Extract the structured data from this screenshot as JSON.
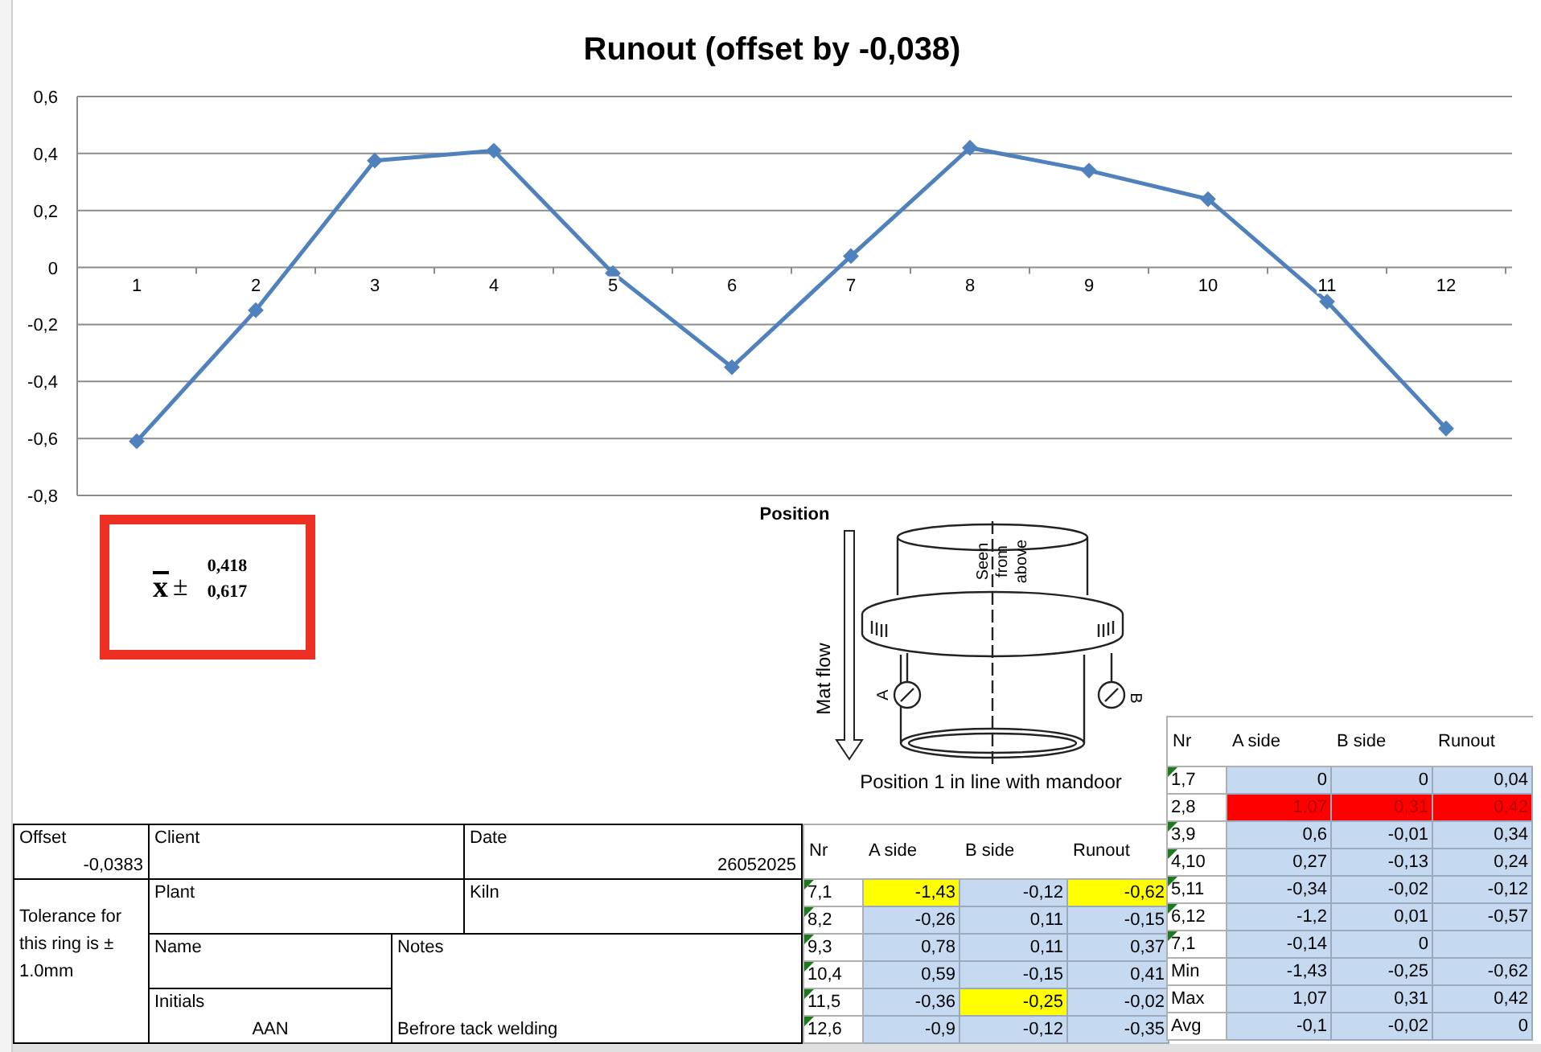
{
  "chart": {
    "chart_data": {
      "type": "line",
      "title": "Runout (offset by -0,038)",
      "xlabel": "Position",
      "categories": [
        "1",
        "2",
        "3",
        "4",
        "5",
        "6",
        "7",
        "8",
        "9",
        "10",
        "11",
        "12"
      ],
      "grid": true,
      "series": [
        {
          "color": "#4f81bd",
          "marker": "diamond",
          "values": [
            -0.61,
            -0.15,
            0.375,
            0.41,
            -0.02,
            -0.35,
            0.04,
            0.42,
            0.34,
            0.24,
            -0.12,
            -0.565
          ]
        }
      ],
      "ylim": [
        -0.8,
        0.6
      ],
      "yticks": [
        {
          "value": 0.6,
          "label": "0,6"
        },
        {
          "value": 0.4,
          "label": "0,4"
        },
        {
          "value": 0.2,
          "label": "0,2"
        },
        {
          "value": 0,
          "label": "0"
        },
        {
          "value": -0.2,
          "label": "-0,2"
        },
        {
          "value": -0.4,
          "label": "-0,4"
        },
        {
          "value": -0.6,
          "label": "-0,6"
        },
        {
          "value": -0.8,
          "label": "-0,8"
        }
      ]
    }
  },
  "mean_box": {
    "symbol": "x",
    "plus_minus": "±",
    "values": [
      "0,418",
      "0,617"
    ]
  },
  "diagram": {
    "seen_from": [
      "Seen",
      "from",
      "above"
    ],
    "flow_label": "Mat flow",
    "gauge_a": "A",
    "gauge_b": "B",
    "caption": "Position 1 in line with mandoor"
  },
  "info": {
    "offset": {
      "label": "Offset",
      "value": "-0,0383"
    },
    "client": {
      "label": "Client"
    },
    "date": {
      "label": "Date",
      "value": "26052025"
    },
    "tolerance": "Tolerance for this ring is ± 1.0mm",
    "plant": {
      "label": "Plant"
    },
    "kiln": {
      "label": "Kiln"
    },
    "name": {
      "label": "Name"
    },
    "notes": {
      "label": "Notes",
      "value": "Befrore tack welding"
    },
    "initials": {
      "label": "Initials",
      "value": "AAN"
    }
  },
  "table_left": {
    "columns": [
      "Nr",
      "A side",
      "B side",
      "Runout"
    ],
    "rows": [
      {
        "nr": "7,1",
        "flagged": true,
        "cells": [
          {
            "text": "-1,43",
            "color": "#ffff00"
          },
          {
            "text": "-0,12",
            "color": "#c5d9f1"
          },
          {
            "text": "-0,62",
            "color": "#ffff00"
          }
        ]
      },
      {
        "nr": "8,2",
        "flagged": true,
        "cells": [
          {
            "text": "-0,26",
            "color": "#c5d9f1"
          },
          {
            "text": "0,11",
            "color": "#c5d9f1"
          },
          {
            "text": "-0,15",
            "color": "#c5d9f1"
          }
        ]
      },
      {
        "nr": "9,3",
        "flagged": true,
        "cells": [
          {
            "text": "0,78",
            "color": "#c5d9f1"
          },
          {
            "text": "0,11",
            "color": "#c5d9f1"
          },
          {
            "text": "0,37",
            "color": "#c5d9f1"
          }
        ]
      },
      {
        "nr": "10,4",
        "flagged": true,
        "cells": [
          {
            "text": "0,59",
            "color": "#c5d9f1"
          },
          {
            "text": "-0,15",
            "color": "#c5d9f1"
          },
          {
            "text": "0,41",
            "color": "#c5d9f1"
          }
        ]
      },
      {
        "nr": "11,5",
        "flagged": true,
        "cells": [
          {
            "text": "-0,36",
            "color": "#c5d9f1"
          },
          {
            "text": "-0,25",
            "color": "#ffff00"
          },
          {
            "text": "-0,02",
            "color": "#c5d9f1"
          }
        ]
      },
      {
        "nr": "12,6",
        "flagged": true,
        "cells": [
          {
            "text": "-0,9",
            "color": "#c5d9f1"
          },
          {
            "text": "-0,12",
            "color": "#c5d9f1"
          },
          {
            "text": "-0,35",
            "color": "#c5d9f1"
          }
        ]
      }
    ]
  },
  "table_right": {
    "columns": [
      "Nr",
      "A side",
      "B side",
      "Runout"
    ],
    "rows": [
      {
        "nr": "1,7",
        "flagged": true,
        "cells": [
          {
            "text": "0",
            "color": "#c5d9f1"
          },
          {
            "text": "0",
            "color": "#c5d9f1"
          },
          {
            "text": "0,04",
            "color": "#c5d9f1"
          }
        ]
      },
      {
        "nr": "2,8",
        "flagged": false,
        "cells": [
          {
            "text": "1,07",
            "color": "#ff0000"
          },
          {
            "text": "0,31",
            "color": "#ff0000"
          },
          {
            "text": "0,42",
            "color": "#ff0000"
          }
        ]
      },
      {
        "nr": "3,9",
        "flagged": true,
        "cells": [
          {
            "text": "0,6",
            "color": "#c5d9f1"
          },
          {
            "text": "-0,01",
            "color": "#c5d9f1"
          },
          {
            "text": "0,34",
            "color": "#c5d9f1"
          }
        ]
      },
      {
        "nr": "4,10",
        "flagged": true,
        "cells": [
          {
            "text": "0,27",
            "color": "#c5d9f1"
          },
          {
            "text": "-0,13",
            "color": "#c5d9f1"
          },
          {
            "text": "0,24",
            "color": "#c5d9f1"
          }
        ]
      },
      {
        "nr": "5,11",
        "flagged": true,
        "cells": [
          {
            "text": "-0,34",
            "color": "#c5d9f1"
          },
          {
            "text": "-0,02",
            "color": "#c5d9f1"
          },
          {
            "text": "-0,12",
            "color": "#c5d9f1"
          }
        ]
      },
      {
        "nr": "6,12",
        "flagged": true,
        "cells": [
          {
            "text": "-1,2",
            "color": "#c5d9f1"
          },
          {
            "text": "0,01",
            "color": "#c5d9f1"
          },
          {
            "text": "-0,57",
            "color": "#c5d9f1"
          }
        ]
      },
      {
        "nr": "7,1",
        "flagged": true,
        "cells": [
          {
            "text": "-0,14",
            "color": "#c5d9f1"
          },
          {
            "text": "0",
            "color": "#c5d9f1"
          },
          {
            "color": "#c5d9f1"
          }
        ]
      },
      {
        "nr": "Min",
        "flagged": false,
        "cells": [
          {
            "text": "-1,43",
            "color": "#c5d9f1"
          },
          {
            "text": "-0,25",
            "color": "#c5d9f1"
          },
          {
            "text": "-0,62",
            "color": "#c5d9f1"
          }
        ]
      },
      {
        "nr": "Max",
        "flagged": false,
        "cells": [
          {
            "text": "1,07",
            "color": "#c5d9f1"
          },
          {
            "text": "0,31",
            "color": "#c5d9f1"
          },
          {
            "text": "0,42",
            "color": "#c5d9f1"
          }
        ]
      },
      {
        "nr": "Avg",
        "flagged": false,
        "cells": [
          {
            "text": "-0,1",
            "color": "#c5d9f1"
          },
          {
            "text": "-0,02",
            "color": "#c5d9f1"
          },
          {
            "text": "0",
            "color": "#c5d9f1"
          }
        ]
      }
    ]
  }
}
